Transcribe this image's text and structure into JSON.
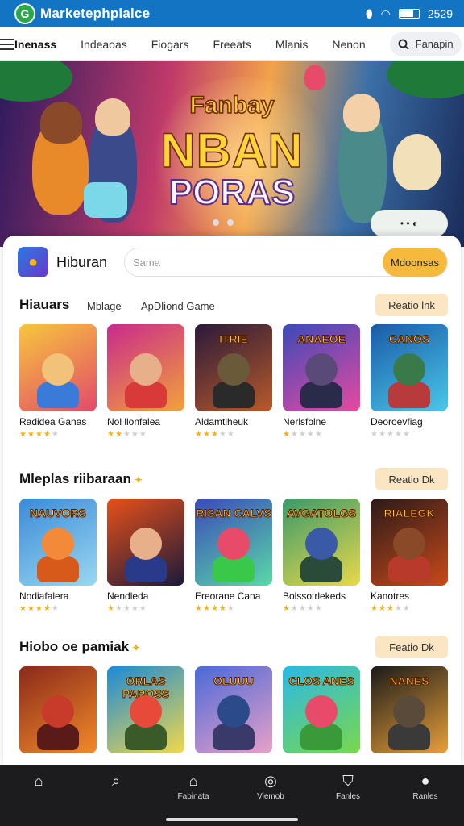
{
  "status": {
    "app_name": "Marketephplalce",
    "time": "2529",
    "logo_letter": "G"
  },
  "nav": {
    "tabs": [
      "Inenass",
      "Indeaoas",
      "Fiogars",
      "Freeats",
      "Mlanis",
      "Nenon"
    ],
    "search_label": "Fanapin"
  },
  "hero": {
    "line1": "Fanbay",
    "line2": "NBAN",
    "line3": "PORAS",
    "toggle_label": "• • ◐"
  },
  "category": {
    "title": "Hiburan",
    "search_placeholder": "Sama",
    "search_button": "Mdoonsas"
  },
  "sections": [
    {
      "title": "Hiauars",
      "chips": [
        "Mblage",
        "ApDliond Game"
      ],
      "see_all": "Reatio lnk",
      "games": [
        {
          "name": "Radidea Ganas",
          "rating": 4,
          "thumb_text": "",
          "colors": [
            "#f7c63d",
            "#e24a6a",
            "#f2c27a",
            "#3a7ad8"
          ]
        },
        {
          "name": "Nol llonfalea",
          "rating": 2,
          "thumb_text": "",
          "colors": [
            "#c92a8c",
            "#f2a23a",
            "#e8b08a",
            "#d83a3a"
          ]
        },
        {
          "name": "Aldamtlheuk",
          "rating": 3,
          "thumb_text": "ITRIE",
          "colors": [
            "#2a1a3a",
            "#b85a2a",
            "#6a5a3a",
            "#2a2a2a"
          ]
        },
        {
          "name": "Nerlsfolne",
          "rating": 1,
          "thumb_text": "ANAEOE",
          "colors": [
            "#3a4ab8",
            "#e84aa0",
            "#5a4a7a",
            "#2a2a4a"
          ]
        },
        {
          "name": "Deoroevfiag",
          "rating": 0,
          "thumb_text": "CANOS",
          "colors": [
            "#1a5aa8",
            "#4ac8e8",
            "#3a7a4a",
            "#b83a3a"
          ]
        }
      ]
    },
    {
      "title": "Mleplas riibaraan",
      "chips": [],
      "see_all": "Reatio Dk",
      "games": [
        {
          "name": "Nodiafalera",
          "rating": 4,
          "thumb_text": "NAUVORS",
          "colors": [
            "#3a8ad8",
            "#9ad8f0",
            "#f28a3a",
            "#d85a1a"
          ]
        },
        {
          "name": "Nendleda",
          "rating": 1,
          "thumb_text": "",
          "colors": [
            "#e8501a",
            "#1a1a3a",
            "#e8b08a",
            "#2a3a8a"
          ]
        },
        {
          "name": "Ereorane Cana",
          "rating": 4,
          "thumb_text": "RISAN CALVS",
          "colors": [
            "#3a4ab8",
            "#5ad8a8",
            "#e84a6a",
            "#3ac84a"
          ]
        },
        {
          "name": "Bolssotrlekeds",
          "rating": 1,
          "thumb_text": "AVGATOLGS",
          "colors": [
            "#3a9a6a",
            "#e8d84a",
            "#3a5aa8",
            "#2a4a3a"
          ]
        },
        {
          "name": "Kanotres",
          "rating": 3,
          "thumb_text": "RIALEGK",
          "colors": [
            "#2a1a1a",
            "#c84a1a",
            "#8a4a2a",
            "#b83a2a"
          ]
        }
      ]
    },
    {
      "title": "Hiobo oe pamiak",
      "chips": [],
      "see_all": "Featio Dk",
      "games": [
        {
          "name": "",
          "rating": 0,
          "thumb_text": "",
          "colors": [
            "#8a2a1a",
            "#f28a2a",
            "#c83a2a",
            "#5a1a1a"
          ]
        },
        {
          "name": "",
          "rating": 0,
          "thumb_text": "ORLAS PAROSS",
          "colors": [
            "#1a8ad8",
            "#f2d84a",
            "#e84a3a",
            "#3a5a2a"
          ]
        },
        {
          "name": "",
          "rating": 0,
          "thumb_text": "OLUUU",
          "colors": [
            "#4a6ad8",
            "#e8a0c8",
            "#2a4a8a",
            "#3a3a6a"
          ]
        },
        {
          "name": "",
          "rating": 0,
          "thumb_text": "CLOS ANES",
          "colors": [
            "#2ab8e8",
            "#7ad84a",
            "#e84a6a",
            "#3a9a3a"
          ]
        },
        {
          "name": "",
          "rating": 0,
          "thumb_text": "NANES",
          "colors": [
            "#1a1a1a",
            "#e8a03a",
            "#5a4a3a",
            "#3a3a3a"
          ]
        }
      ]
    }
  ],
  "bottom_nav": [
    {
      "icon": "home-icon",
      "label": ""
    },
    {
      "icon": "search-icon",
      "label": ""
    },
    {
      "icon": "store-icon",
      "label": "Fabinata"
    },
    {
      "icon": "compass-icon",
      "label": "Viemob"
    },
    {
      "icon": "shield-icon",
      "label": "Fanles"
    },
    {
      "icon": "profile-icon",
      "label": "Ranles"
    }
  ]
}
